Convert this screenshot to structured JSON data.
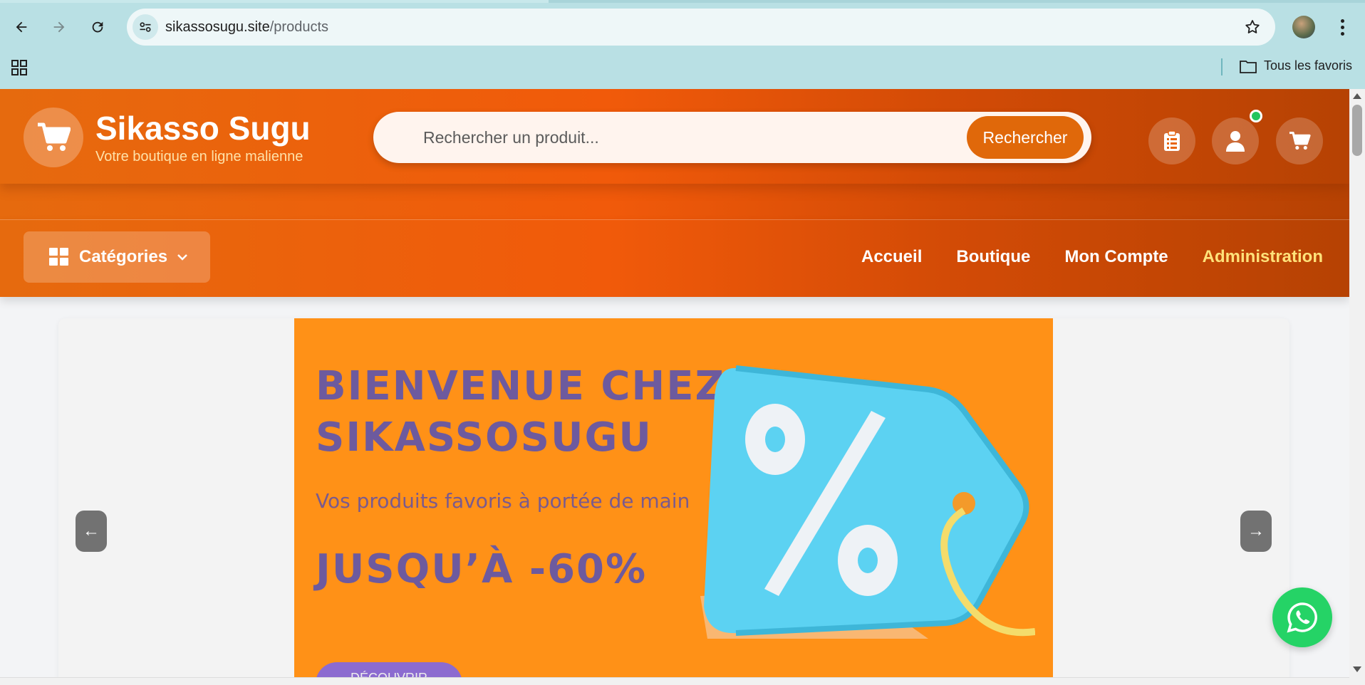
{
  "browser": {
    "url_domain": "sikassosugu.site",
    "url_path": "/products",
    "bookmarks_label": "Tous les favoris"
  },
  "header": {
    "brand": "Sikasso Sugu",
    "tagline": "Votre boutique en ligne malienne",
    "search_placeholder": "Rechercher un produit...",
    "search_button": "Rechercher",
    "notification_online": true
  },
  "nav": {
    "categories_label": "Catégories",
    "links": [
      "Accueil",
      "Boutique",
      "Mon Compte",
      "Administration"
    ]
  },
  "banner": {
    "title_line1": "BIENVENUE CHEZ",
    "title_line2": "SIKASSOSUGU",
    "subtitle": "Vos produits favoris à portée de main",
    "promo": "JUSQU’À -60%",
    "cta_label": "DÉCOUVRIR",
    "prev_label": "←",
    "next_label": "→"
  },
  "colors": {
    "header_orange": "#f15a0a",
    "search_button": "#e0680a",
    "admin_link": "#ffe27a",
    "banner_bg": "#ff9117",
    "banner_text": "#6d5a9e",
    "whatsapp": "#25d366"
  },
  "icons": {
    "logo": "cart-icon",
    "orders": "clipboard-icon",
    "account": "user-icon",
    "cart": "cart-icon",
    "categories": "grid-icon",
    "chat": "whatsapp-icon"
  }
}
